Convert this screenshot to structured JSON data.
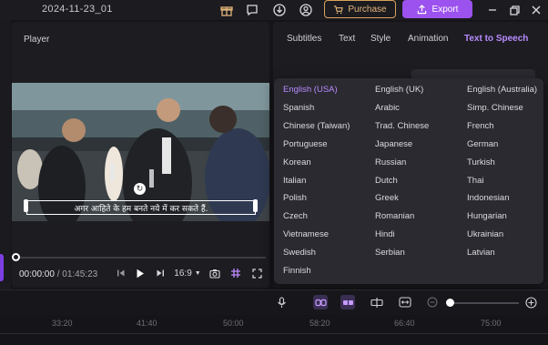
{
  "window": {
    "title": "2024-11-23_01"
  },
  "titlebar": {
    "purchase_label": "Purchase",
    "export_label": "Export",
    "icons": [
      "gift-icon",
      "feedback-icon",
      "download-icon",
      "account-icon",
      "minimize-icon",
      "restore-icon",
      "close-icon"
    ]
  },
  "player": {
    "title": "Player",
    "caption": "अगर आहिते के हम बनते नये में कर सकते हैं.",
    "time_current": "00:00:00",
    "time_separator": "/",
    "time_total": "01:45:23",
    "aspect_ratio": "16:9",
    "progress": 0
  },
  "right_panel": {
    "tabs": [
      "Subtitles",
      "Text",
      "Style",
      "Animation",
      "Text to Speech"
    ],
    "active_tab": "Text to Speech"
  },
  "language_dropdown": {
    "selected": "English (USA)",
    "options": [
      [
        "English (USA)",
        "English (UK)",
        "English (Australia)"
      ],
      [
        "Spanish",
        "Arabic",
        "Simp. Chinese"
      ],
      [
        "Chinese (Taiwan)",
        "Trad. Chinese",
        "French"
      ],
      [
        "Portuguese",
        "Japanese",
        "German"
      ],
      [
        "Korean",
        "Russian",
        "Turkish"
      ],
      [
        "Italian",
        "Dutch",
        "Thai"
      ],
      [
        "Polish",
        "Greek",
        "Indonesian"
      ],
      [
        "Czech",
        "Romanian",
        "Hungarian"
      ],
      [
        "Vietnamese",
        "Hindi",
        "Ukrainian"
      ],
      [
        "Swedish",
        "Serbian",
        "Latvian"
      ],
      [
        "Finnish",
        "",
        ""
      ]
    ]
  },
  "timeline": {
    "ruler_labels": [
      "33:20",
      "41:40",
      "50:00",
      "58:20",
      "66:40",
      "75:00"
    ],
    "zoom_level": 0
  },
  "colors": {
    "accent": "#9c52ee",
    "selected_text": "#b98cff",
    "purchase": "#d9a35a"
  }
}
